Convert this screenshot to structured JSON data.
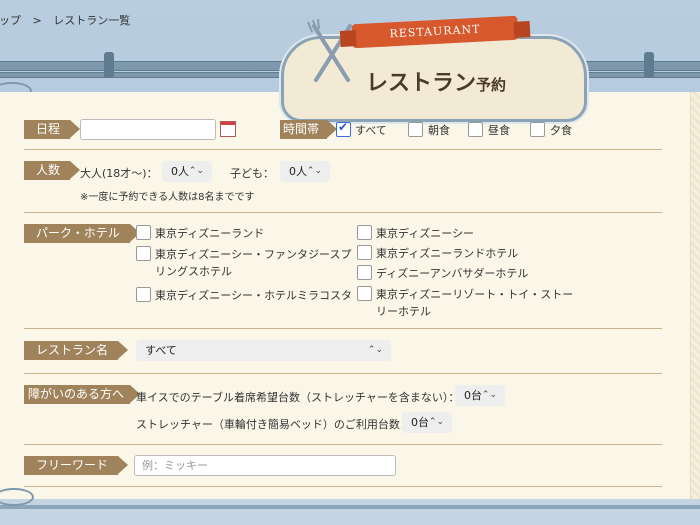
{
  "breadcrumb": {
    "home": "トップ",
    "sep": ">",
    "current": "レストラン一覧"
  },
  "logo": {
    "ribbon": "RESTAURANT",
    "title": "レストラン",
    "title_suffix": "予約"
  },
  "date": {
    "label": "日程",
    "value": ""
  },
  "time": {
    "label": "時間帯",
    "options": [
      {
        "label": "すべて",
        "checked": true
      },
      {
        "label": "朝食",
        "checked": false
      },
      {
        "label": "昼食",
        "checked": false
      },
      {
        "label": "夕食",
        "checked": false
      }
    ]
  },
  "people": {
    "label": "人数",
    "adult_label": "大人(18才〜)：",
    "adult_value": "0人",
    "child_label": "子ども：",
    "child_value": "0人",
    "note": "※一度に予約できる人数は8名までです"
  },
  "park": {
    "label": "パーク・ホテル",
    "left": [
      {
        "label": "東京ディズニーランド",
        "line2": ""
      },
      {
        "label": "東京ディズニーシー・ファンタジースプ",
        "line2": "リングスホテル"
      },
      {
        "label": "東京ディズニーシー・ホテルミラコスタ",
        "line2": ""
      }
    ],
    "right": [
      {
        "label": "東京ディズニーシー",
        "line2": ""
      },
      {
        "label": "東京ディズニーランドホテル",
        "line2": ""
      },
      {
        "label": "ディズニーアンバサダーホテル",
        "line2": ""
      },
      {
        "label": "東京ディズニーリゾート・トイ・ストー",
        "line2": "リーホテル"
      }
    ]
  },
  "restaurant": {
    "label": "レストラン名",
    "value": "すべて"
  },
  "accessibility": {
    "label": "障がいのある方へ",
    "wheelchair_label": "車イスでのテーブル着席希望台数（ストレッチャーを含まない）：",
    "wheelchair_value": "0台",
    "stretcher_label": "ストレッチャー（車輪付き簡易ベッド）のご利用台数：",
    "stretcher_value": "0台"
  },
  "freeword": {
    "label": "フリーワード",
    "placeholder": "例：ミッキー"
  }
}
